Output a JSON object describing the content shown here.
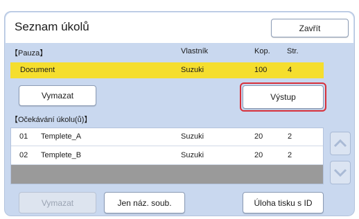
{
  "header": {
    "title": "Seznam úkolů",
    "close_label": "Zavřít"
  },
  "paused": {
    "section_label": "【Pauza】",
    "columns": {
      "owner": "Vlastník",
      "copies": "Kop.",
      "pages": "Str."
    },
    "row": {
      "name": "Document",
      "owner": "Suzuki",
      "copies": "100",
      "pages": "4"
    },
    "delete_label": "Vymazat",
    "output_label": "Výstup"
  },
  "waiting": {
    "section_label": "【Očekávání úkolu(ů)】",
    "rows": [
      {
        "num": "01",
        "name": "Templete_A",
        "owner": "Suzuki",
        "copies": "20",
        "pages": "2"
      },
      {
        "num": "02",
        "name": "Templete_B",
        "owner": "Suzuki",
        "copies": "20",
        "pages": "2"
      }
    ]
  },
  "footer": {
    "delete_label": "Vymazat",
    "filename_only_label": "Jen náz. soub.",
    "print_by_id_label": "Úloha tisku s ID"
  },
  "colors": {
    "panel_bg": "#c9d8ef",
    "paused_highlight": "#f5de2e",
    "focus_ring": "#d7303a"
  }
}
